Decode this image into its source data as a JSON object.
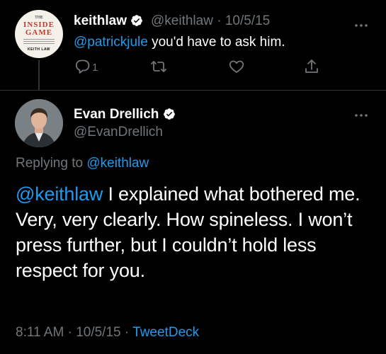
{
  "tweet1": {
    "display_name": "keithlaw",
    "handle": "@keithlaw",
    "separator": "·",
    "date": "10/5/15",
    "mention": "@patrickjule",
    "text": " you'd have to ask him.",
    "reply_count": "1",
    "avatar_book": {
      "line_top": "THE",
      "title": "INSIDE GAME",
      "author": "KEITH LAW"
    }
  },
  "tweet2": {
    "display_name": "Evan Drellich",
    "handle": "@EvanDrellich",
    "replying_prefix": "Replying to ",
    "replying_to": "@keithlaw",
    "mention": "@keithlaw",
    "text": " I explained what bothered me. Very, very clearly. How spineless. I won’t press further, but I couldn’t hold less respect for you.",
    "time": "8:11 AM",
    "meta_sep": " · ",
    "date": "10/5/15",
    "source": "TweetDeck"
  },
  "colors": {
    "background": "#000000",
    "link": "#1d9bf0",
    "secondary_text": "#71767b",
    "verified_badge": "#ffffff"
  },
  "icons": [
    "verified-badge-icon",
    "more-options-icon",
    "reply-icon",
    "retweet-icon",
    "like-icon",
    "share-icon"
  ]
}
